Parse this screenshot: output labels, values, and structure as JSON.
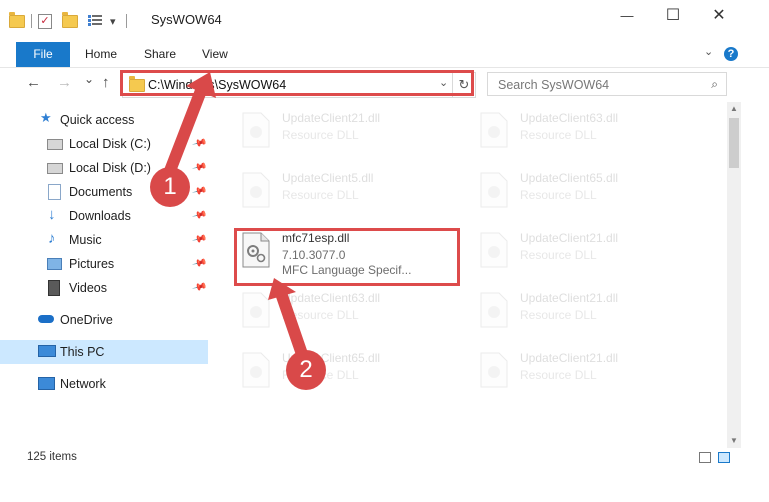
{
  "window": {
    "title": "SysWOW64",
    "controls": {
      "minimize": "—",
      "maximize": "☐",
      "close": "✕"
    }
  },
  "quick_access_toolbar": {
    "dropdown": "▾"
  },
  "ribbon": {
    "tabs": [
      "File",
      "Home",
      "Share",
      "View"
    ],
    "help": "?",
    "collapse": "⌄"
  },
  "navigation": {
    "back": "←",
    "forward": "→",
    "recent": "⌄",
    "up": "↑",
    "address": "C:\\Windows\\SysWOW64",
    "address_dropdown": "⌄",
    "refresh": "↻",
    "search_placeholder": "Search SysWOW64",
    "search_icon": "⌕"
  },
  "sidebar": {
    "items": [
      {
        "label": "Quick access",
        "icon": "star-icon",
        "pinned": false
      },
      {
        "label": "Local Disk (C:)",
        "icon": "drive-icon",
        "pinned": true
      },
      {
        "label": "Local Disk (D:)",
        "icon": "drive-icon",
        "pinned": true
      },
      {
        "label": "Documents",
        "icon": "documents-icon",
        "pinned": true
      },
      {
        "label": "Downloads",
        "icon": "download-icon",
        "pinned": true
      },
      {
        "label": "Music",
        "icon": "music-icon",
        "pinned": true
      },
      {
        "label": "Pictures",
        "icon": "pictures-icon",
        "pinned": true
      },
      {
        "label": "Videos",
        "icon": "videos-icon",
        "pinned": true
      },
      {
        "label": "OneDrive",
        "icon": "cloud-icon",
        "pinned": false
      },
      {
        "label": "This PC",
        "icon": "computer-icon",
        "pinned": false,
        "selected": true
      },
      {
        "label": "Network",
        "icon": "network-icon",
        "pinned": false
      }
    ]
  },
  "files": [
    {
      "name": "UpdateClient21.dll",
      "type": "Resource DLL",
      "faded": true
    },
    {
      "name": "UpdateClient63.dll",
      "type": "Resource DLL",
      "faded": true
    },
    {
      "name": "UpdateClient5.dll",
      "type": "Resource DLL",
      "faded": true
    },
    {
      "name": "UpdateClient65.dll",
      "type": "Resource DLL",
      "faded": true
    },
    {
      "name": "mfc71esp.dll",
      "version": "7.10.3077.0",
      "type": "MFC Language Specif...",
      "faded": false
    },
    {
      "name": "UpdateClient21.dll",
      "type": "Resource DLL",
      "faded": true
    },
    {
      "name": "UpdateClient63.dll",
      "type": "Resource DLL",
      "faded": true
    },
    {
      "name": "UpdateClient21.dll",
      "type": "Resource DLL",
      "faded": true
    },
    {
      "name": "UpdateClient65.dll",
      "type": "Resource DLL",
      "faded": true
    },
    {
      "name": "UpdateClient21.dll",
      "type": "Resource DLL",
      "faded": true
    }
  ],
  "status": {
    "item_count": "125 items"
  },
  "callouts": [
    "1",
    "2"
  ],
  "colors": {
    "accent": "#1979ca",
    "highlight": "#dd4b4b",
    "selected": "#cce8ff",
    "folder": "#f5c94f"
  }
}
